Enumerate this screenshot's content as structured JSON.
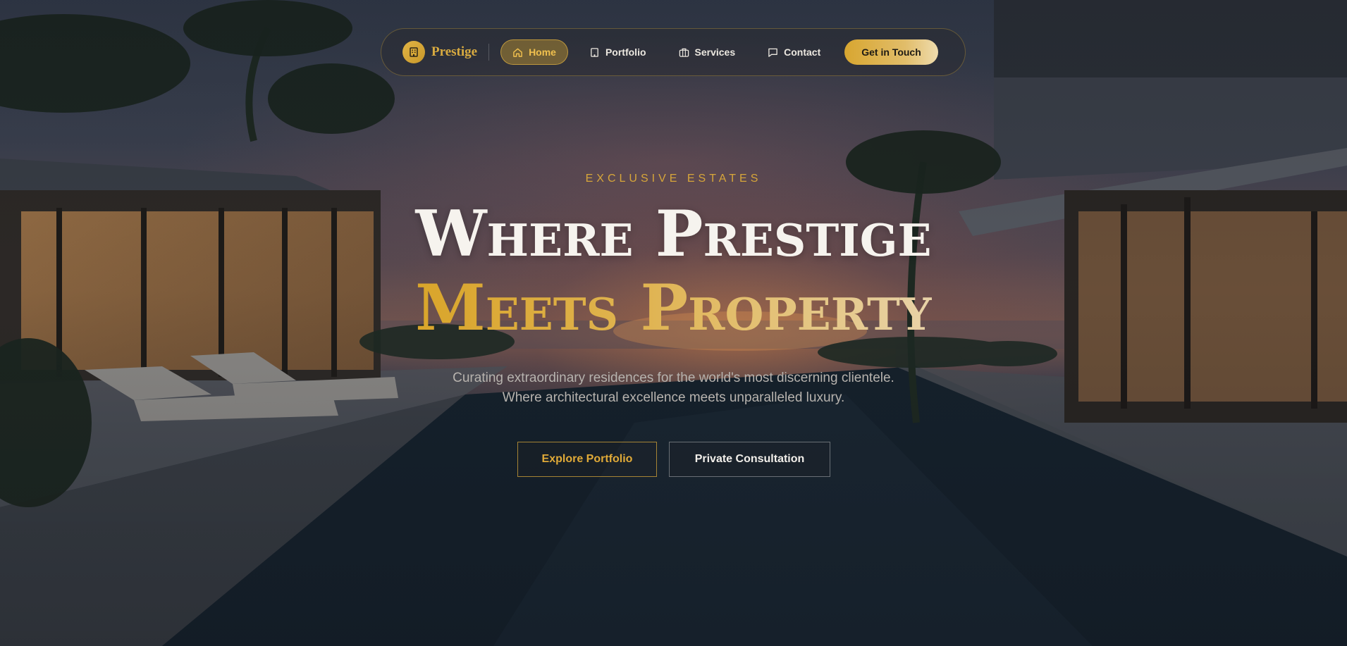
{
  "brand": {
    "name": "Prestige",
    "icon": "building-icon"
  },
  "nav": {
    "items": [
      {
        "label": "Home",
        "icon": "home-icon",
        "active": true
      },
      {
        "label": "Portfolio",
        "icon": "building-icon",
        "active": false
      },
      {
        "label": "Services",
        "icon": "briefcase-icon",
        "active": false
      },
      {
        "label": "Contact",
        "icon": "message-icon",
        "active": false
      }
    ],
    "cta_label": "Get in Touch"
  },
  "hero": {
    "eyebrow": "EXCLUSIVE ESTATES",
    "headline_line1": "Where Prestige",
    "headline_line2": "Meets Property",
    "subtitle": "Curating extraordinary residences for the world's most discerning clientele. Where architectural excellence meets unparalleled luxury.",
    "primary_button": "Explore Portfolio",
    "secondary_button": "Private Consultation"
  },
  "colors": {
    "accent_gold": "#d9a62f",
    "text_light": "#f6f3ee",
    "text_muted": "#b7b3ae"
  }
}
